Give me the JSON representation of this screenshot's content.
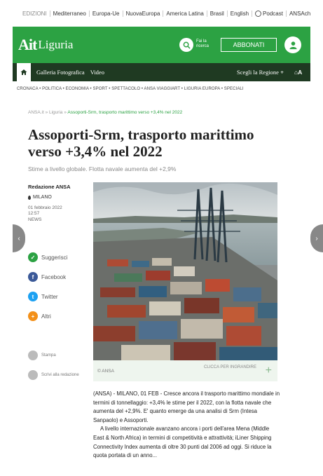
{
  "editions": [
    "EDIZIONI",
    "Mediterraneo",
    "Europa-Ue",
    "NuovaEuropa",
    "America Latina",
    "Brasil",
    "English",
    "Podcast",
    "ANSAcheck"
  ],
  "header": {
    "logo_ait": "Ait",
    "logo_region": "Liguria",
    "search_label": "Fai la ricerca",
    "subscribe_label": "ABBONATI",
    "brand_color": "#2ca243"
  },
  "nav": {
    "items": [
      "Galleria Fotografica",
      "Video"
    ],
    "region_label": "Scegli la Regione",
    "tools_label": "A"
  },
  "sections": "CRONACA • POLITICA • ECONOMIA • SPORT • SPETTACOLO • ANSA VIAGGIART • LIGURIA EUROPA • SPECIALI",
  "breadcrumb": {
    "root": "ANSA.it",
    "region": "Liguria",
    "current": "Assoporti-Srm, trasporto marittimo verso +3,4% nel 2022"
  },
  "article": {
    "title": "Assoporti-Srm, trasporto marittimo verso +3,4% nel 2022",
    "subtitle": "Stime a livello globale. Flotta navale aumenta del +2,9%",
    "author": "Redazione ANSA",
    "location": "MILANO",
    "date": "01 febbraio 2022",
    "time": "12:57",
    "category": "NEWS",
    "photo_credit": "© ANSA",
    "expand_label": "CLICCA PER INGRANDIRE",
    "paragraph1": "(ANSA) - MILANO, 01 FEB - Cresce ancora il trasporto marittimo mondiale in termini di tonnellaggio: +3,4% le stime per il 2022, con la flotta navale che aumenta del +2,9%. E' quanto emerge da una analisi di Srm (Intesa Sanpaolo) e Assoporti.",
    "paragraph2": "A livello internazionale avanzano ancora i porti dell'area Mena (Middle East & North Africa) in termini di competitività e attrattività; iLiner Shipping Connectivity Index aumenta di oltre 30 punti dal 2006 ad oggi. Si riduce la quota portata di un anno..."
  },
  "share": {
    "suggest": "Suggerisci",
    "facebook": "Facebook",
    "twitter": "Twitter",
    "others": "Altri",
    "print": "Stampa",
    "write": "Scrivi alla redazione"
  }
}
